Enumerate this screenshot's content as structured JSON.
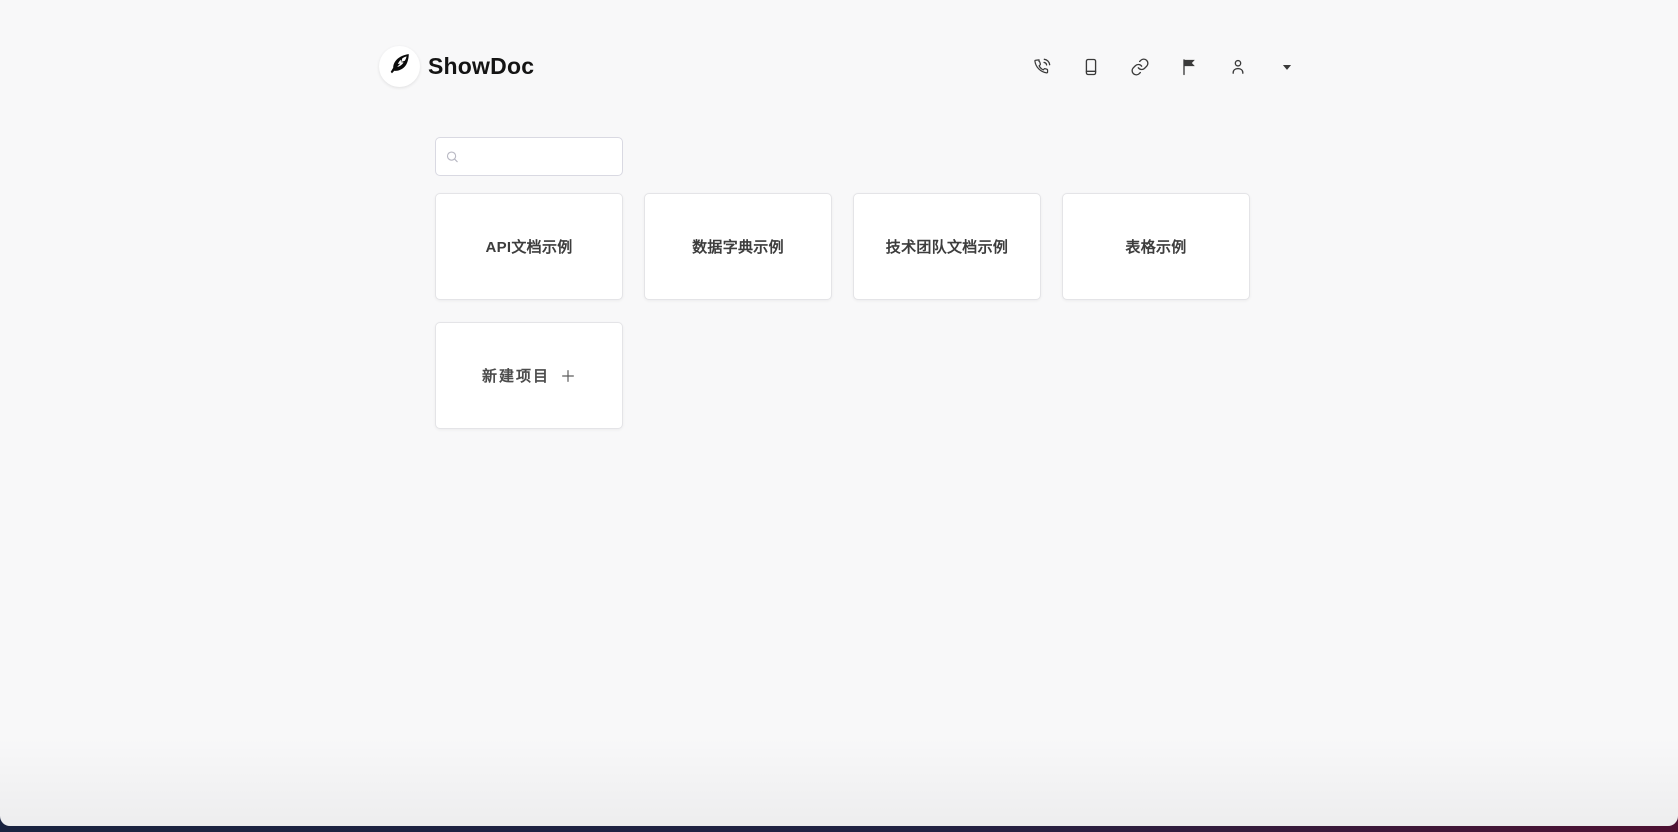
{
  "app": {
    "name": "ShowDoc"
  },
  "header": {
    "logo_text": "ShowDoc",
    "logo_icon": "feather-icon",
    "nav_icons": [
      {
        "name": "phone-call-icon"
      },
      {
        "name": "smartphone-icon"
      },
      {
        "name": "link-icon"
      },
      {
        "name": "flag-icon"
      },
      {
        "name": "user-icon"
      },
      {
        "name": "caret-down-icon"
      }
    ]
  },
  "search": {
    "value": "",
    "placeholder": "",
    "icon": "search-icon"
  },
  "projects": [
    {
      "title": "API文档示例"
    },
    {
      "title": "数据字典示例"
    },
    {
      "title": "技术团队文档示例"
    },
    {
      "title": "表格示例"
    }
  ],
  "new_project": {
    "label": "新建项目",
    "icon": "plus-icon"
  },
  "colors": {
    "page_bg": "#f8f8f9",
    "card_bg": "#ffffff",
    "card_border": "#e4e4e7",
    "bottom_bar_left": "#1a2340",
    "bottom_bar_right": "#4e1233"
  }
}
